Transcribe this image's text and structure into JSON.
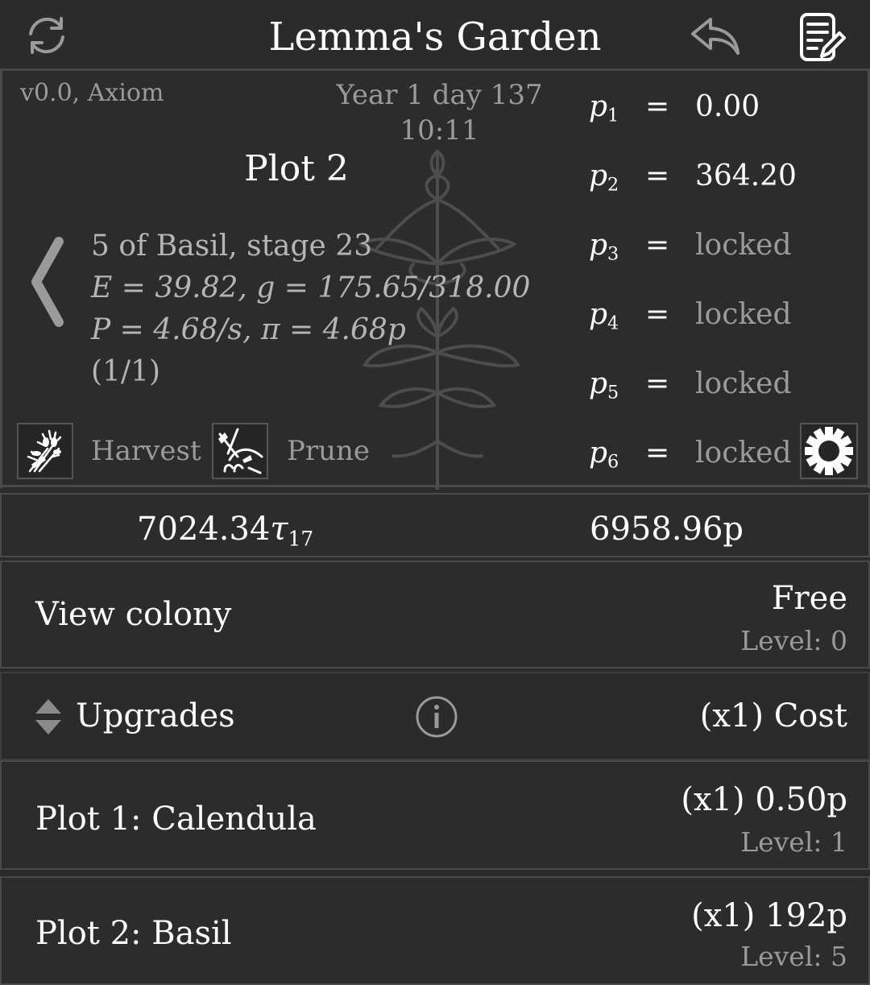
{
  "header": {
    "title": "Lemma's Garden"
  },
  "info": {
    "version": "v0.0, Axiom",
    "date": "Year 1 day 137",
    "time": "10:11"
  },
  "plot": {
    "name": "Plot 2",
    "line1": "5 of Basil,  stage 23",
    "line2": "E = 39.82,  g = 175.65/318.00",
    "line3": "P = 4.68/s,  π = 4.68p",
    "line4": "(1/1)"
  },
  "actions": {
    "harvest_label": "Harvest",
    "prune_label": "Prune"
  },
  "params": [
    {
      "name": "p",
      "sub": "1",
      "eq": "=",
      "value": "0.00",
      "locked": false
    },
    {
      "name": "p",
      "sub": "2",
      "eq": "=",
      "value": "364.20",
      "locked": false
    },
    {
      "name": "p",
      "sub": "3",
      "eq": "=",
      "value": "locked",
      "locked": true
    },
    {
      "name": "p",
      "sub": "4",
      "eq": "=",
      "value": "locked",
      "locked": true
    },
    {
      "name": "p",
      "sub": "5",
      "eq": "=",
      "value": "locked",
      "locked": true
    },
    {
      "name": "p",
      "sub": "6",
      "eq": "=",
      "value": "locked",
      "locked": true
    }
  ],
  "currency": {
    "tau_value": "7024.34",
    "tau_symbol": "τ",
    "tau_sub": "17",
    "p_value": "6958.96p"
  },
  "colony": {
    "label": "View colony",
    "price": "Free",
    "level": "Level: 0"
  },
  "upgrades_header": {
    "label": "Upgrades",
    "cost_label": "(x1) Cost"
  },
  "upgrades": [
    {
      "name": "Plot 1: Calendula",
      "cost": "(x1) 0.50p",
      "level": "Level: 1"
    },
    {
      "name": "Plot 2: Basil",
      "cost": "(x1) 192p",
      "level": "Level: 5"
    }
  ],
  "icons": {
    "refresh": "refresh-icon",
    "undo": "undo-icon",
    "notes": "notes-icon",
    "back": "chevron-left-icon",
    "harvest": "harvest-icon",
    "prune": "prune-icon",
    "settings": "gear-icon",
    "info": "info-icon",
    "sort": "sort-arrows-icon"
  },
  "colors": {
    "background": "#2b2b2b",
    "border": "#4a4a4a",
    "text": "#ffffff",
    "dim_text": "#9a9a9a"
  }
}
